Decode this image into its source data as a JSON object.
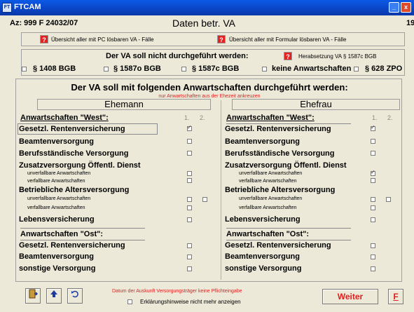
{
  "window": {
    "app_icon": "FT",
    "title": "FTCAM",
    "minimize_label": "_",
    "close_label": "x"
  },
  "header": {
    "az": "Az:  999 F 24032/07",
    "title": "Daten betr. VA",
    "right_number": "19"
  },
  "overview": {
    "pc_label": "Übersicht aller mit PC lösbaren VA - Fälle",
    "formular_label": "Übersicht aller mit Formular lösbaren VA - Fälle"
  },
  "not_done": {
    "heading": "Der VA soll nicht durchgeführt werden:",
    "herabsetzung": "Herabsetzung VA § 1587c BGB",
    "options": [
      {
        "label": "§ 1408 BGB",
        "checked": false
      },
      {
        "label": "§ 1587o BGB",
        "checked": false
      },
      {
        "label": "§ 1587c BGB",
        "checked": false
      },
      {
        "label": "keine Anwartschaften",
        "checked": false
      },
      {
        "label": "§ 628 ZPO",
        "checked": false
      }
    ]
  },
  "main": {
    "title": "Der VA soll mit folgenden Anwartschaften durchgeführt werden:",
    "subtitle": "nur Anwartschaften aus der Ehezeit ankreuzen",
    "col1_label": "1.",
    "col2_label": "2.",
    "west_heading": "Anwartschaften \"West\":",
    "ost_heading": "Anwartschaften \"Ost\":",
    "husband": {
      "heading": "Ehemann",
      "west": {
        "gesetzl": "Gesetzl. Rentenversicherung",
        "beamten": "Beamtenversorgung",
        "berufs": "Berufsständische Versorgung",
        "zusatz": "Zusatzversorgung Öffentl. Dienst",
        "zusatz_unverfallbar": "unverfallbare Anwartschaften",
        "zusatz_verfallbar": "verfallbare    Anwartschaften",
        "betrieb": "Betriebliche Altersversorgung",
        "betrieb_unverfallbar": "unverfallbare Anwartschaften",
        "betrieb_verfallbar": "verfallbare    Anwartschaften",
        "leben": "Lebensversicherung"
      },
      "ost": {
        "gesetzl": "Gesetzl. Rentenversicherung",
        "beamten": "Beamtenversorgung",
        "sonstige": "sonstige Versorgung"
      }
    },
    "wife": {
      "heading": "Ehefrau",
      "west": {
        "gesetzl": "Gesetzl. Rentenversicherung",
        "beamten": "Beamtenversorgung",
        "berufs": "Berufsständische Versorgung",
        "zusatz": "Zusatzversorgung Öffentl. Dienst",
        "zusatz_unverfallbar": "unverfallbare Anwartschaften",
        "zusatz_verfallbar": "verfallbare    Anwartschaften",
        "betrieb": "Betriebliche Altersversorgung",
        "betrieb_unverfallbar": "unverfallbare Anwartschaften",
        "betrieb_verfallbar": "verfallbare    Anwartschaften",
        "leben": "Lebensversicherung"
      },
      "ost": {
        "gesetzl": "Gesetzl. Rentenversicherung",
        "beamten": "Beamtenversorgung",
        "sonstige": "sonstige Versorgung"
      }
    },
    "checkbox_states": {
      "husband_gesetzl_west": true,
      "wife_gesetzl_west": true,
      "wife_zusatz_unverfallbar": true
    }
  },
  "footer": {
    "note": "Datum der Auskunft Versorgungsträger keine Pflichteingabe",
    "checkbox_label": "Erklärungshinweise nicht mehr anzeigen",
    "weiter": "Weiter",
    "f": "F",
    "icons": [
      "exit-door-icon",
      "up-arrow-icon",
      "undo-icon"
    ]
  },
  "colors": {
    "accent_red": "#e02020",
    "titlebar_blue": "#0a44c4",
    "background": "#ece9d8"
  }
}
